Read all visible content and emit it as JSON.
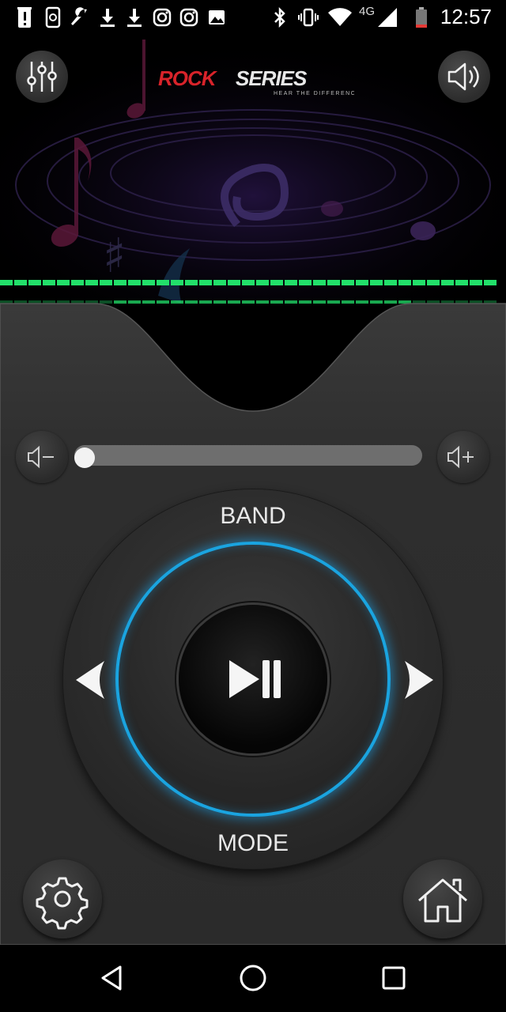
{
  "status_bar": {
    "time": "12:57",
    "network": "4G",
    "icons": [
      "alert-icon",
      "phone-sync-icon",
      "wrench-icon",
      "download-icon",
      "download-icon",
      "instagram-icon",
      "instagram-icon",
      "image-icon",
      "bluetooth-icon",
      "vibrate-icon",
      "wifi-icon",
      "signal-icon",
      "battery-icon"
    ]
  },
  "header": {
    "logo_text": "ROCK SERIES",
    "logo_tagline": "HEAR THE DIFFERENCE",
    "equalizer_icon": "equalizer-icon",
    "speaker_icon": "speaker-icon"
  },
  "volume": {
    "level": 0.0,
    "down_icon": "volume-down-icon",
    "up_icon": "volume-up-icon"
  },
  "dial": {
    "top_label": "BAND",
    "bottom_label": "MODE",
    "center_icon": "play-pause-icon",
    "left_icon": "previous-arrow-icon",
    "right_icon": "next-arrow-icon",
    "accent_color": "#1aa4e0"
  },
  "corner_buttons": {
    "settings_icon": "gear-icon",
    "home_icon": "home-icon"
  },
  "colors": {
    "eq_bar": "#22e06a",
    "panel": "#2e2e2e",
    "logo_red": "#d8232a"
  }
}
